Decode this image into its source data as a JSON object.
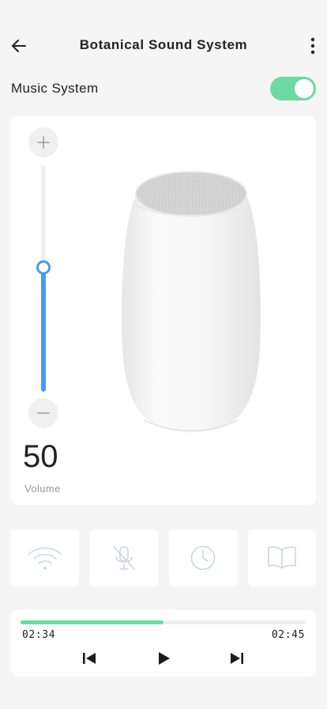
{
  "header": {
    "title": "Botanical Sound System",
    "back_icon": "arrow-left-icon",
    "more_icon": "more-vertical-icon"
  },
  "system": {
    "label": "Music System",
    "enabled": true,
    "accent": "#6ed9a2"
  },
  "volume": {
    "value": "50",
    "label": "Volume",
    "level": 0.55,
    "accent": "#4d9be6",
    "plus_icon": "plus-icon",
    "minus_icon": "minus-icon"
  },
  "controls": [
    {
      "name": "wifi",
      "icon": "wifi-icon"
    },
    {
      "name": "mic-off",
      "icon": "mic-off-icon"
    },
    {
      "name": "timer",
      "icon": "clock-icon"
    },
    {
      "name": "book",
      "icon": "book-icon"
    }
  ],
  "player": {
    "current_time": "02:34",
    "total_time": "02:45",
    "progress": 0.5,
    "prev_icon": "skip-previous-icon",
    "play_icon": "play-icon",
    "next_icon": "skip-next-icon"
  }
}
